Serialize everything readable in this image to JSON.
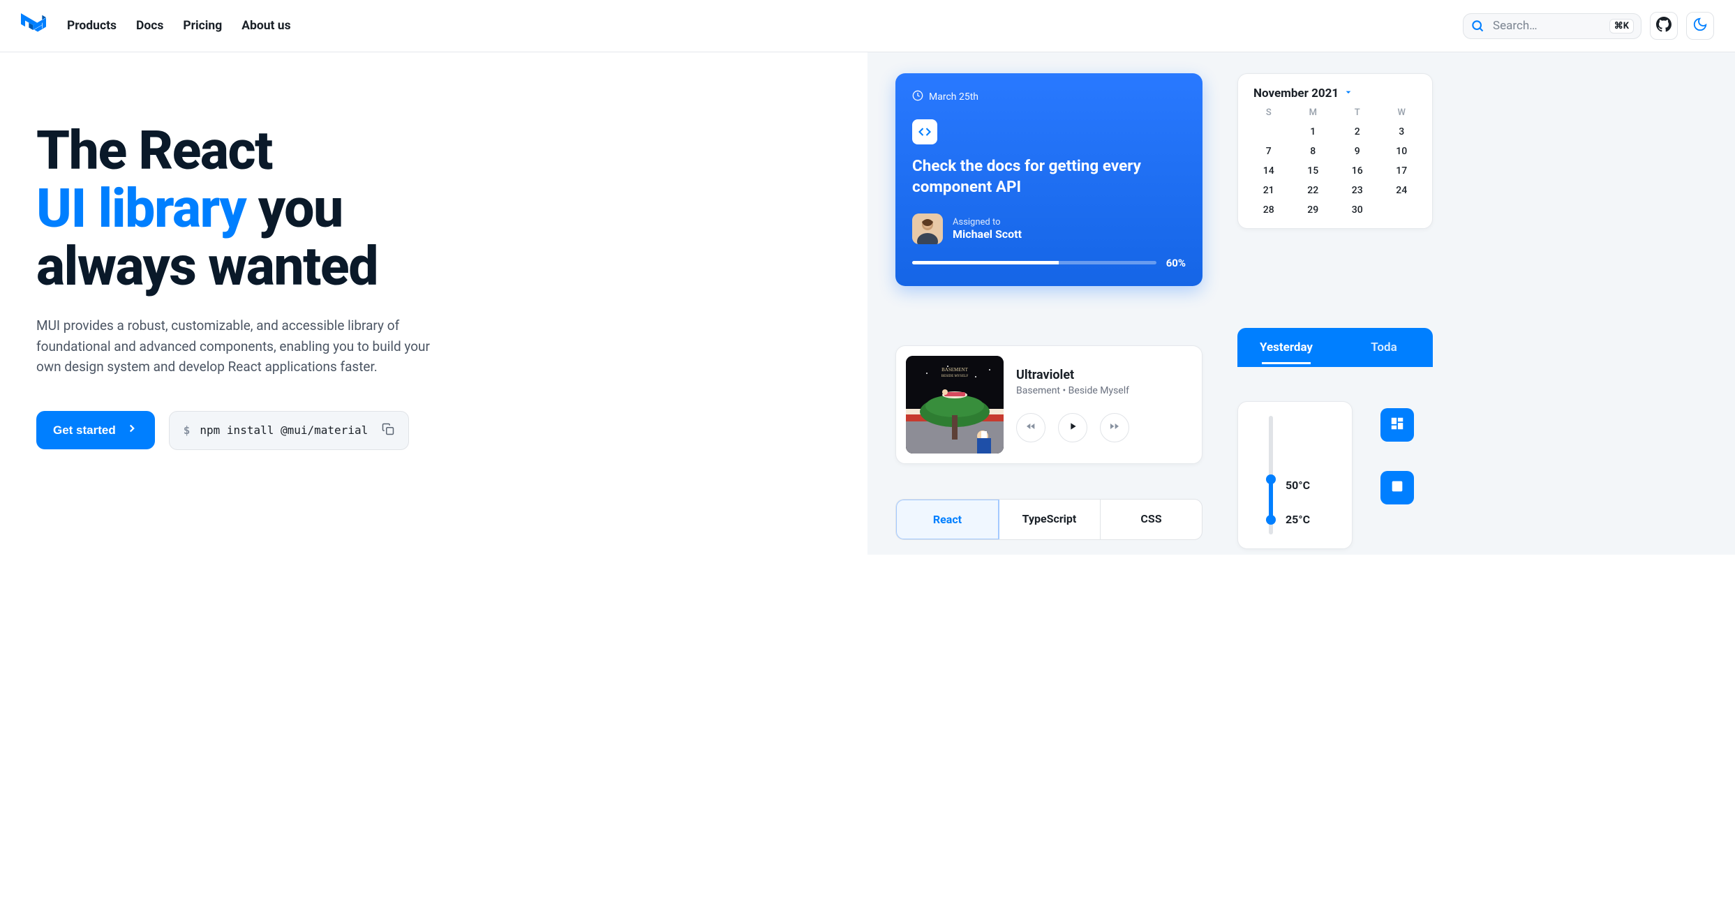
{
  "nav": {
    "items": [
      "Products",
      "Docs",
      "Pricing",
      "About us"
    ]
  },
  "search": {
    "placeholder": "Search…",
    "kbd": "⌘K"
  },
  "hero": {
    "line1": "The React",
    "line2": "UI library",
    "line3_a": " you",
    "line3_b": "always wanted",
    "subtitle": "MUI provides a robust, customizable, and accessible library of foundational and advanced components, enabling you to build your own design system and develop React applications faster.",
    "cta": "Get started",
    "install_cmd": "npm install @mui/material"
  },
  "task": {
    "date": "March 25th",
    "title": "Check the docs for getting every component API",
    "assigned_label": "Assigned to",
    "assignee": "Michael Scott",
    "progress": "60%"
  },
  "calendar": {
    "month": "November 2021",
    "dow": [
      "S",
      "M",
      "T",
      "W"
    ],
    "rows": [
      [
        "",
        "1",
        "2",
        "3"
      ],
      [
        "7",
        "8",
        "9",
        "10"
      ],
      [
        "14",
        "15",
        "16",
        "17"
      ],
      [
        "21",
        "22",
        "23",
        "24"
      ],
      [
        "28",
        "29",
        "30",
        ""
      ]
    ]
  },
  "media": {
    "title": "Ultraviolet",
    "artist": "Basement • Beside Myself"
  },
  "tabs": {
    "items": [
      "React",
      "TypeScript",
      "CSS"
    ]
  },
  "daytabs": {
    "items": [
      "Yesterday",
      "Toda"
    ]
  },
  "temp": {
    "hi": "50°C",
    "lo": "25°C"
  }
}
